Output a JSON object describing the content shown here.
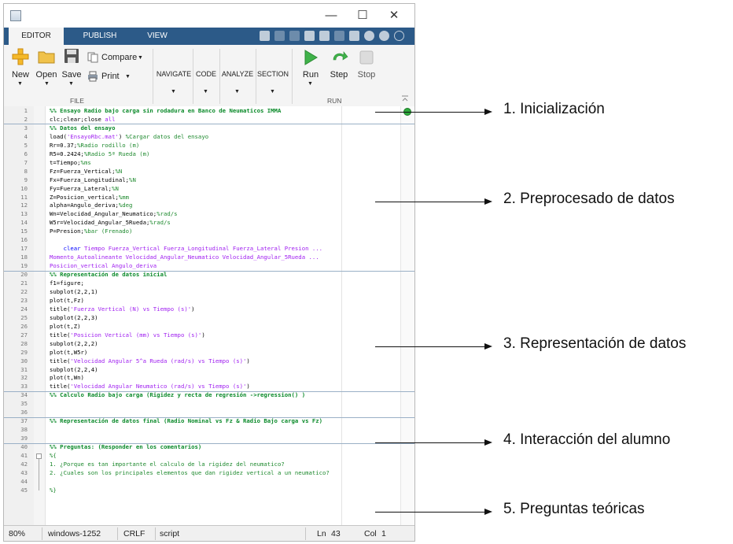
{
  "window": {
    "controls": {
      "minimize": "—",
      "maximize": "☐",
      "close": "✕"
    }
  },
  "tabs": [
    {
      "label": "EDITOR"
    },
    {
      "label": "PUBLISH"
    },
    {
      "label": "VIEW"
    }
  ],
  "ribbon": {
    "new_label": "New",
    "open_label": "Open",
    "save_label": "Save",
    "compare_label": "Compare",
    "print_label": "Print",
    "navigate_label": "NAVIGATE",
    "code_label": "CODE",
    "analyze_label": "ANALYZE",
    "section_label": "SECTION",
    "run_label": "Run",
    "step_label": "Step",
    "stop_label": "Stop",
    "file_section": "FILE",
    "run_section": "RUN"
  },
  "code_lines": [
    {
      "n": "1",
      "text": "%% Ensayo Radio bajo carga sin rodadura en Banco de Neumaticos IMMA",
      "kind": "section"
    },
    {
      "n": "2",
      "text": "clc;clear;close all",
      "kind": "code"
    },
    {
      "n": "3",
      "text": "%% Datos del ensayo",
      "kind": "section"
    },
    {
      "n": "4",
      "text": "load('EnsayoRbc.mat') %Cargar datos del ensayo",
      "kind": "code"
    },
    {
      "n": "5",
      "text": "Rr=0.37;%Radio rodillo (m)",
      "kind": "code"
    },
    {
      "n": "6",
      "text": "R5=0.2424;%Radio 5ª Rueda (m)",
      "kind": "code"
    },
    {
      "n": "7",
      "text": "t=Tiempo;%ms",
      "kind": "code"
    },
    {
      "n": "8",
      "text": "Fz=Fuerza_Vertical;%N",
      "kind": "code"
    },
    {
      "n": "9",
      "text": "Fx=Fuerza_Longitudinal;%N",
      "kind": "code"
    },
    {
      "n": "10",
      "text": "Fy=Fuerza_Lateral;%N",
      "kind": "code"
    },
    {
      "n": "11",
      "text": "Z=Posicion_vertical;%mm",
      "kind": "code"
    },
    {
      "n": "12",
      "text": "alpha=Angulo_deriva;%deg",
      "kind": "code"
    },
    {
      "n": "13",
      "text": "Wn=Velocidad_Angular_Neumatico;%rad/s",
      "kind": "code"
    },
    {
      "n": "14",
      "text": "W5r=Velocidad_Angular_5Rueda;%rad/s",
      "kind": "code"
    },
    {
      "n": "15",
      "text": "P=Presion;%bar (Frenado)",
      "kind": "code"
    },
    {
      "n": "16",
      "text": "",
      "kind": "code"
    },
    {
      "n": "17",
      "text": "    clear Tiempo Fuerza_Vertical Fuerza_Longitudinal Fuerza_Lateral Presion ...",
      "kind": "code"
    },
    {
      "n": "18",
      "text": "Momento_Autoalineante Velocidad_Angular_Neumatico Velocidad_Angular_5Rueda ...",
      "kind": "code"
    },
    {
      "n": "19",
      "text": "Posicion_vertical Angulo_deriva",
      "kind": "code"
    },
    {
      "n": "20",
      "text": "%% Representación de datos inicial",
      "kind": "section"
    },
    {
      "n": "21",
      "text": "f1=figure;",
      "kind": "code"
    },
    {
      "n": "22",
      "text": "subplot(2,2,1)",
      "kind": "code"
    },
    {
      "n": "23",
      "text": "plot(t,Fz)",
      "kind": "code"
    },
    {
      "n": "24",
      "text": "title('Fuerza Vertical (N) vs Tiempo (s)')",
      "kind": "code"
    },
    {
      "n": "25",
      "text": "subplot(2,2,3)",
      "kind": "code"
    },
    {
      "n": "26",
      "text": "plot(t,Z)",
      "kind": "code"
    },
    {
      "n": "27",
      "text": "title('Posicion Vertical (mm) vs Tiempo (s)')",
      "kind": "code"
    },
    {
      "n": "28",
      "text": "subplot(2,2,2)",
      "kind": "code"
    },
    {
      "n": "29",
      "text": "plot(t,W5r)",
      "kind": "code"
    },
    {
      "n": "30",
      "text": "title('Velocidad Angular 5^a Rueda (rad/s) vs Tiempo (s)')",
      "kind": "code"
    },
    {
      "n": "31",
      "text": "subplot(2,2,4)",
      "kind": "code"
    },
    {
      "n": "32",
      "text": "plot(t,Wn)",
      "kind": "code"
    },
    {
      "n": "33",
      "text": "title('Velocidad Angular Neumatico (rad/s) vs Tiempo (s)')",
      "kind": "code"
    },
    {
      "n": "34",
      "text": "%% Calculo Radio bajo carga (Rigidez y recta de regresión ->regression() )",
      "kind": "section"
    },
    {
      "n": "35",
      "text": "",
      "kind": "code"
    },
    {
      "n": "36",
      "text": "",
      "kind": "code"
    },
    {
      "n": "37",
      "text": "%% Representación de datos final (Radio Nominal vs Fz & Radio Bajo carga vs Fz)",
      "kind": "section"
    },
    {
      "n": "38",
      "text": "",
      "kind": "code"
    },
    {
      "n": "39",
      "text": "",
      "kind": "code"
    },
    {
      "n": "40",
      "text": "%% Preguntas: (Responder en los comentarios)",
      "kind": "section"
    },
    {
      "n": "41",
      "text": "%{",
      "kind": "comment"
    },
    {
      "n": "42",
      "text": "1. ¿Porque es tan importante el calculo de la rigidez del neumatico?",
      "kind": "comment"
    },
    {
      "n": "43",
      "text": "2. ¿Cuales son los principales elementos que dan rigidez vertical a un neumatico?",
      "kind": "comment"
    },
    {
      "n": "44",
      "text": "",
      "kind": "comment"
    },
    {
      "n": "45",
      "text": "%}",
      "kind": "comment"
    }
  ],
  "status": {
    "zoom": "80%",
    "encoding": "windows-1252",
    "line_ending": "CRLF",
    "file_type": "script",
    "ln_label": "Ln",
    "ln_value": "43",
    "col_label": "Col",
    "col_value": "1"
  },
  "annotations": [
    {
      "text": "1. Inicialización"
    },
    {
      "text": "2. Preprocesado de datos"
    },
    {
      "text": "3. Representación de datos"
    },
    {
      "text": "4. Interacción del alumno"
    },
    {
      "text": "5. Preguntas teóricas"
    }
  ],
  "colors": {
    "tab_bar": "#2c5a88",
    "section": "#0b8a2a",
    "comment": "#1f8a2f",
    "string": "#a020f0",
    "keyword": "#0000ff",
    "code": "#000000"
  }
}
